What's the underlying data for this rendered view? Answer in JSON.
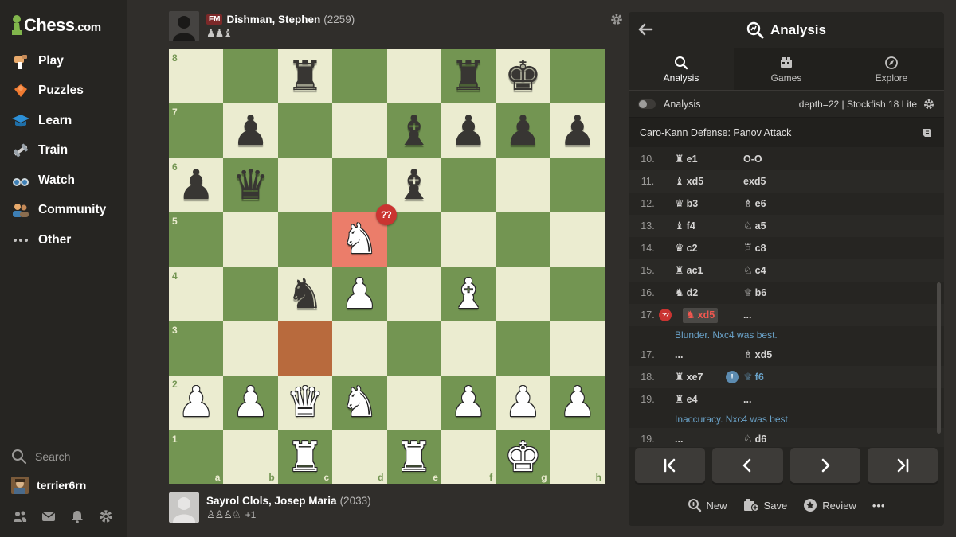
{
  "brand": {
    "name": "Chess",
    "domain": ".com"
  },
  "nav": [
    {
      "label": "Play",
      "icon": "play-icon"
    },
    {
      "label": "Puzzles",
      "icon": "puzzle-icon"
    },
    {
      "label": "Learn",
      "icon": "learn-icon"
    },
    {
      "label": "Train",
      "icon": "train-icon"
    },
    {
      "label": "Watch",
      "icon": "watch-icon"
    },
    {
      "label": "Community",
      "icon": "community-icon"
    },
    {
      "label": "Other",
      "icon": "more-icon"
    }
  ],
  "sidebar_bottom": {
    "search_label": "Search",
    "username": "terrier6rn"
  },
  "top_player": {
    "title": "FM",
    "name": "Dishman, Stephen",
    "rating": "(2259)",
    "captured": "♟♟♝"
  },
  "bottom_player": {
    "name": "Sayrol Clols, Josep Maria",
    "rating": "(2033)",
    "captured": "♙♙♙♘",
    "material": "+1"
  },
  "board": {
    "files": [
      "a",
      "b",
      "c",
      "d",
      "e",
      "f",
      "g",
      "h"
    ],
    "ranks": [
      "8",
      "7",
      "6",
      "5",
      "4",
      "3",
      "2",
      "1"
    ],
    "squares": {
      "c8": "bR",
      "f8": "bR",
      "g8": "bK",
      "b7": "bP",
      "e7": "bB",
      "f7": "bP",
      "g7": "bP",
      "h7": "bP",
      "a6": "bP",
      "b6": "bQ",
      "e6": "bB",
      "d5": "wN",
      "c4": "bN",
      "d4": "wP",
      "f4": "wB",
      "a2": "wP",
      "b2": "wP",
      "c2": "wQ",
      "d2": "wN",
      "f2": "wP",
      "g2": "wP",
      "h2": "wP",
      "c1": "wR",
      "e1": "wR",
      "g1": "wK"
    },
    "highlight_from": "c3",
    "highlight_to": "d5",
    "blunder_square": "d5",
    "blunder_mark": "??"
  },
  "panel": {
    "title": "Analysis",
    "tabs": [
      {
        "label": "Analysis",
        "active": true
      },
      {
        "label": "Games",
        "active": false
      },
      {
        "label": "Explore",
        "active": false
      }
    ],
    "engine": {
      "label": "Analysis",
      "info": "depth=22 | Stockfish 18 Lite"
    },
    "opening": "Caro-Kann Defense: Panov Attack",
    "moves": [
      {
        "num": "10.",
        "w": {
          "p": "♜",
          "m": "e1"
        },
        "b": {
          "p": "",
          "m": "O-O"
        }
      },
      {
        "num": "11.",
        "w": {
          "p": "♝",
          "m": "xd5"
        },
        "b": {
          "p": "",
          "m": "exd5"
        }
      },
      {
        "num": "12.",
        "w": {
          "p": "♛",
          "m": "b3"
        },
        "b": {
          "p": "♗",
          "m": "e6"
        }
      },
      {
        "num": "13.",
        "w": {
          "p": "♝",
          "m": "f4"
        },
        "b": {
          "p": "♘",
          "m": "a5"
        }
      },
      {
        "num": "14.",
        "w": {
          "p": "♛",
          "m": "c2"
        },
        "b": {
          "p": "♖",
          "m": "c8"
        }
      },
      {
        "num": "15.",
        "w": {
          "p": "♜",
          "m": "ac1"
        },
        "b": {
          "p": "♘",
          "m": "c4"
        }
      },
      {
        "num": "16.",
        "w": {
          "p": "♞",
          "m": "d2"
        },
        "b": {
          "p": "♕",
          "m": "b6"
        }
      },
      {
        "num": "17.",
        "w": {
          "p": "♞",
          "m": "xd5",
          "blunder": true
        },
        "b": {
          "p": "",
          "m": "..."
        },
        "comment": "Blunder. Nxc4 was best."
      },
      {
        "num": "17.",
        "w": {
          "p": "",
          "m": "..."
        },
        "b": {
          "p": "♗",
          "m": "xd5"
        }
      },
      {
        "num": "18.",
        "w": {
          "p": "♜",
          "m": "xe7"
        },
        "b": {
          "p": "♕",
          "m": "f6",
          "inaccuracy": true
        }
      },
      {
        "num": "19.",
        "w": {
          "p": "♜",
          "m": "e4"
        },
        "b": {
          "p": "",
          "m": "..."
        },
        "comment": "Inaccuracy. Nxc4 was best."
      },
      {
        "num": "19.",
        "w": {
          "p": "",
          "m": "..."
        },
        "b": {
          "p": "♘",
          "m": "d6"
        }
      }
    ],
    "annotations": {
      "blunder": "??",
      "inaccuracy": "!"
    },
    "footer": {
      "new": "New",
      "save": "Save",
      "review": "Review",
      "more": "•••"
    }
  },
  "colors": {
    "light_square": "#ebecd0",
    "dark_square": "#739552",
    "blunder": "#ca3431",
    "accent_blue": "#6aa2c8"
  }
}
